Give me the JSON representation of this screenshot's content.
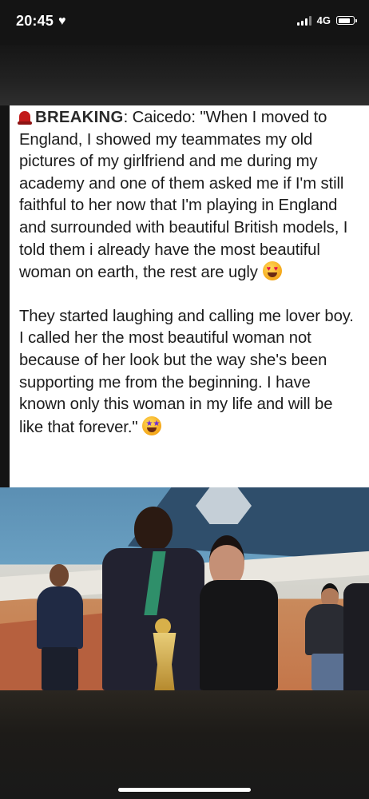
{
  "status_bar": {
    "time": "20:45",
    "status_icon": "heart-icon",
    "network": "4G",
    "icons": [
      "signal-icon",
      "battery-icon"
    ]
  },
  "post": {
    "breaking_label": "BREAKING",
    "intro": ": Caicedo: \"When I moved to England, I showed my teammates my old pictures of my girlfriend and me during my academy and one of them asked me if   I'm still faithful to her now that I'm playing in England and surrounded with beautiful British models, I told them i already have the most beautiful woman on earth, the rest are ugly",
    "intro_emoji": "heart-eyes-emoji",
    "second_paragraph": "They started laughing and calling me lover boy. I called her the most beautiful woman not because of her look but the way she's been supporting me from the beginning. I have known only this woman in my life and will be like that forever.\"",
    "second_emoji": "star-struck-emoji"
  },
  "photo": {
    "subject": "photo-of-player-and-girlfriend"
  }
}
